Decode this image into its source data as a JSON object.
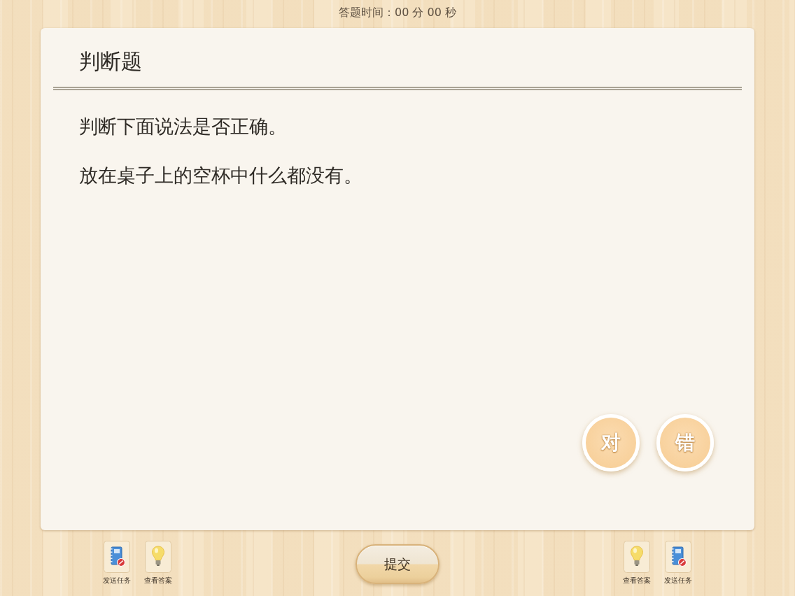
{
  "timer": "答题时间：00 分 00 秒",
  "question": {
    "type_title": "判断题",
    "prompt": "判断下面说法是否正确。",
    "statement": "放在桌子上的空杯中什么都没有。"
  },
  "answer_buttons": [
    {
      "label": "对",
      "selected": false
    },
    {
      "label": "错",
      "selected": false
    }
  ],
  "toolbar_left": [
    {
      "kind": "send",
      "label": "发送任务"
    },
    {
      "kind": "answer",
      "label": "查看答案"
    }
  ],
  "submit_button": "提交",
  "toolbar_right": [
    {
      "kind": "answer",
      "label": "查看答案"
    },
    {
      "kind": "send",
      "label": "发送任务"
    }
  ]
}
